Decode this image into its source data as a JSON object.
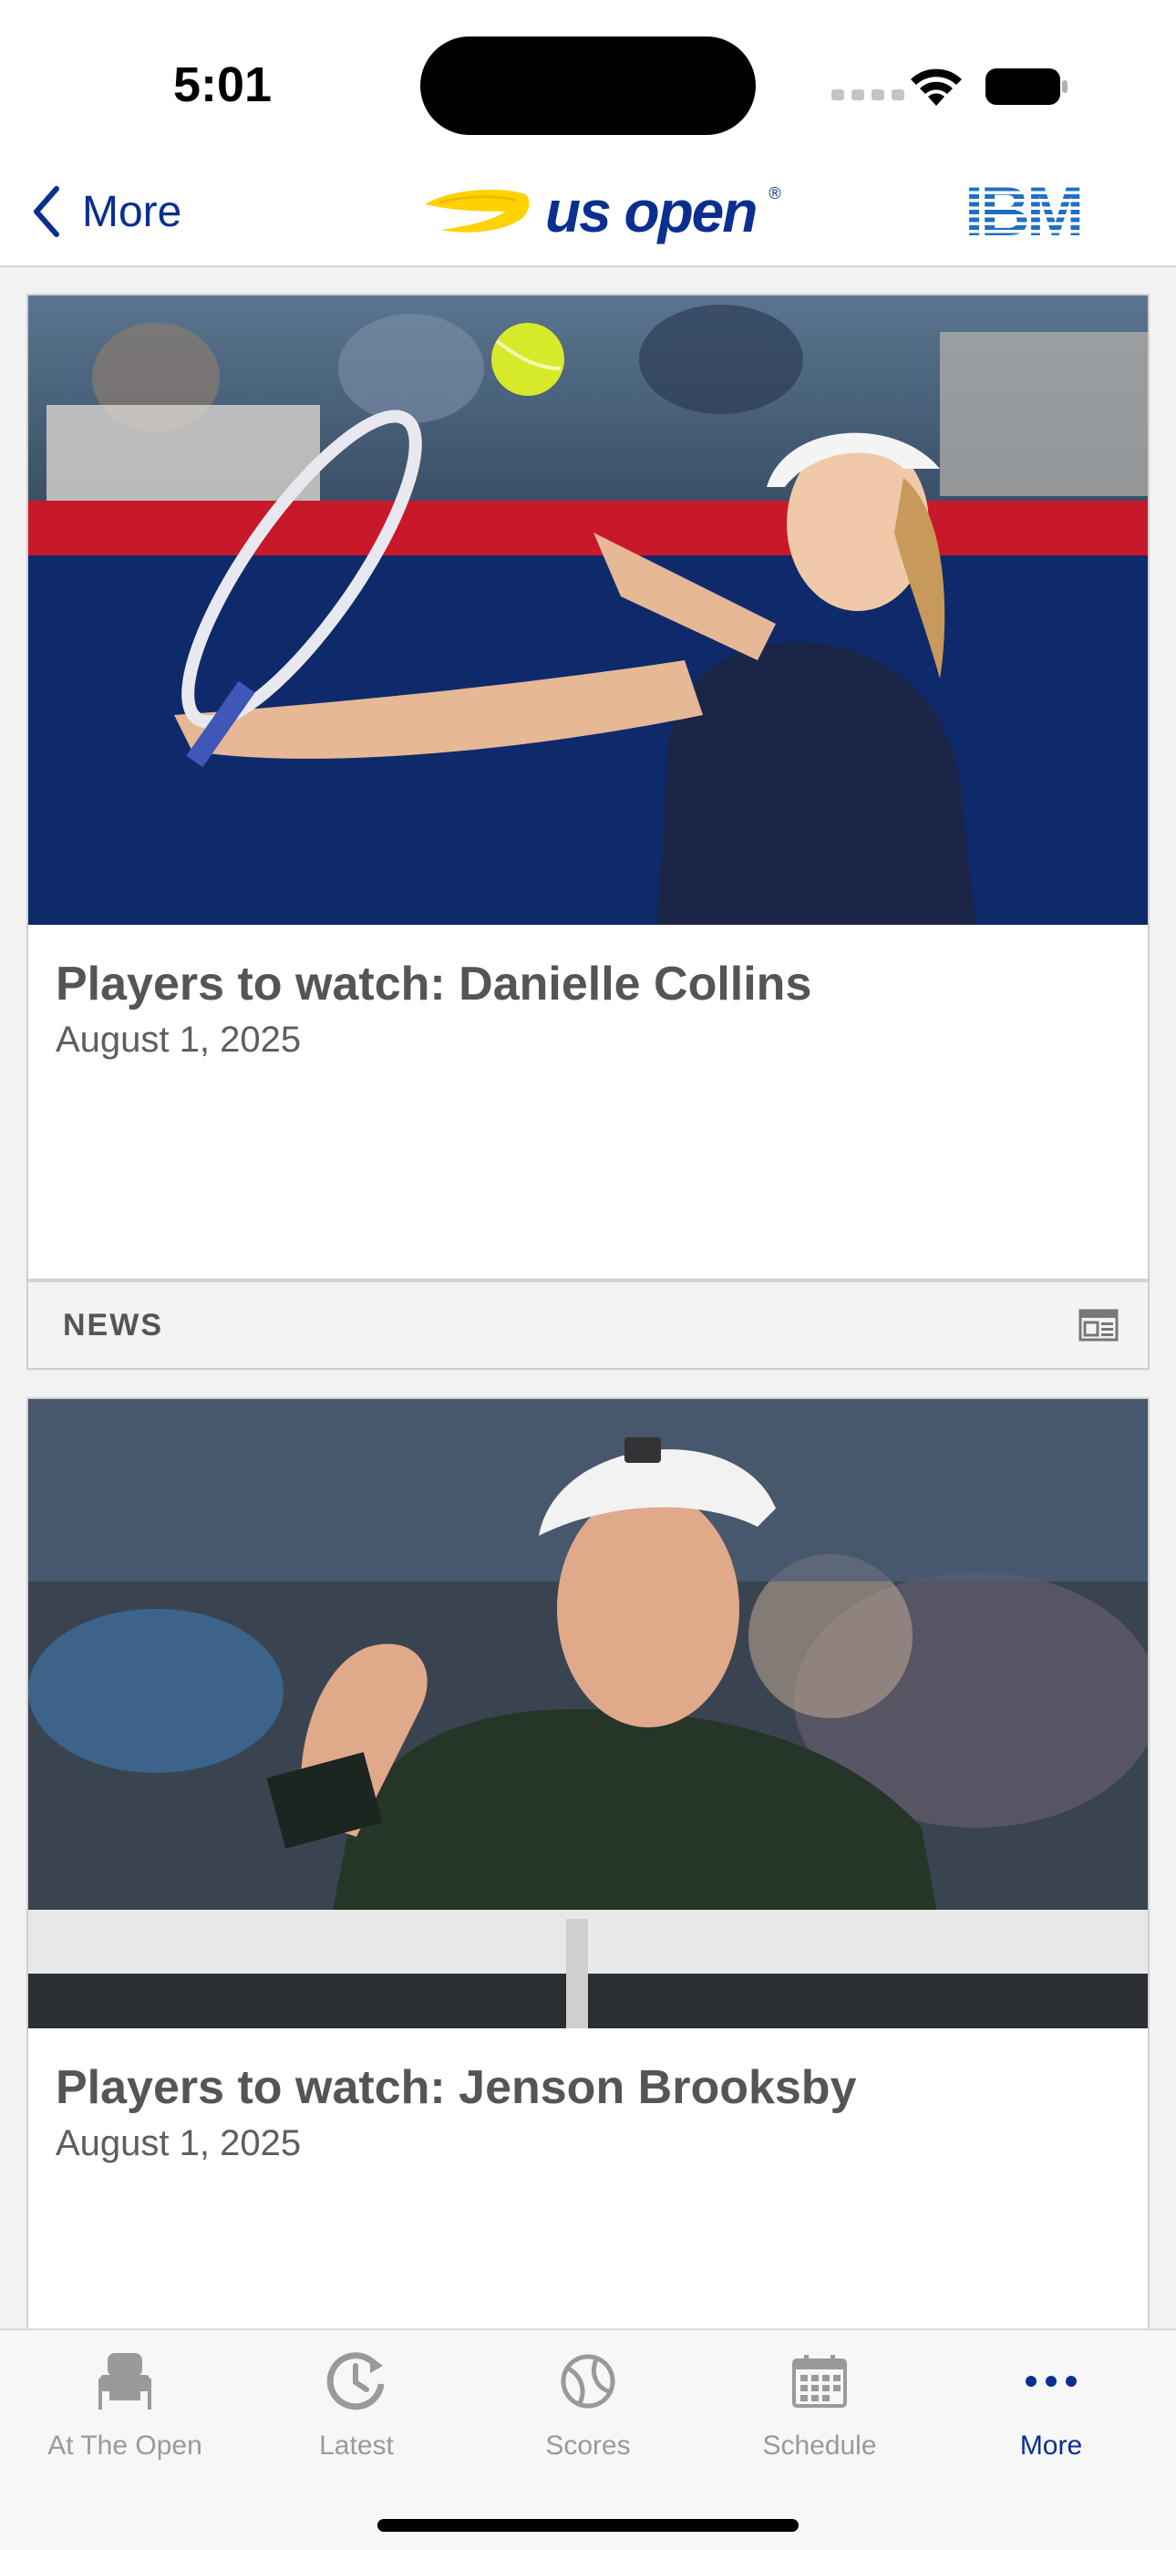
{
  "status_bar": {
    "time": "5:01"
  },
  "nav": {
    "back_label": "More",
    "logo_text": "us open",
    "logo_mark": "®",
    "partner_logo": "IBM"
  },
  "articles": [
    {
      "title": "Players to watch: Danielle Collins",
      "date": "August 1, 2025",
      "tag": "NEWS",
      "tag_icon": "article-icon"
    },
    {
      "title": "Players to watch: Jenson Brooksby",
      "date": "August 1, 2025"
    }
  ],
  "tabs": [
    {
      "label": "At The Open",
      "icon": "stadium-seat-icon",
      "active": false
    },
    {
      "label": "Latest",
      "icon": "clock-refresh-icon",
      "active": false
    },
    {
      "label": "Scores",
      "icon": "tennis-ball-icon",
      "active": false
    },
    {
      "label": "Schedule",
      "icon": "calendar-icon",
      "active": false
    },
    {
      "label": "More",
      "icon": "more-dots-icon",
      "active": true
    }
  ],
  "colors": {
    "brand_blue": "#0a2f8f",
    "logo_yellow": "#ffd200",
    "inactive_tab": "#9a9a9a"
  }
}
